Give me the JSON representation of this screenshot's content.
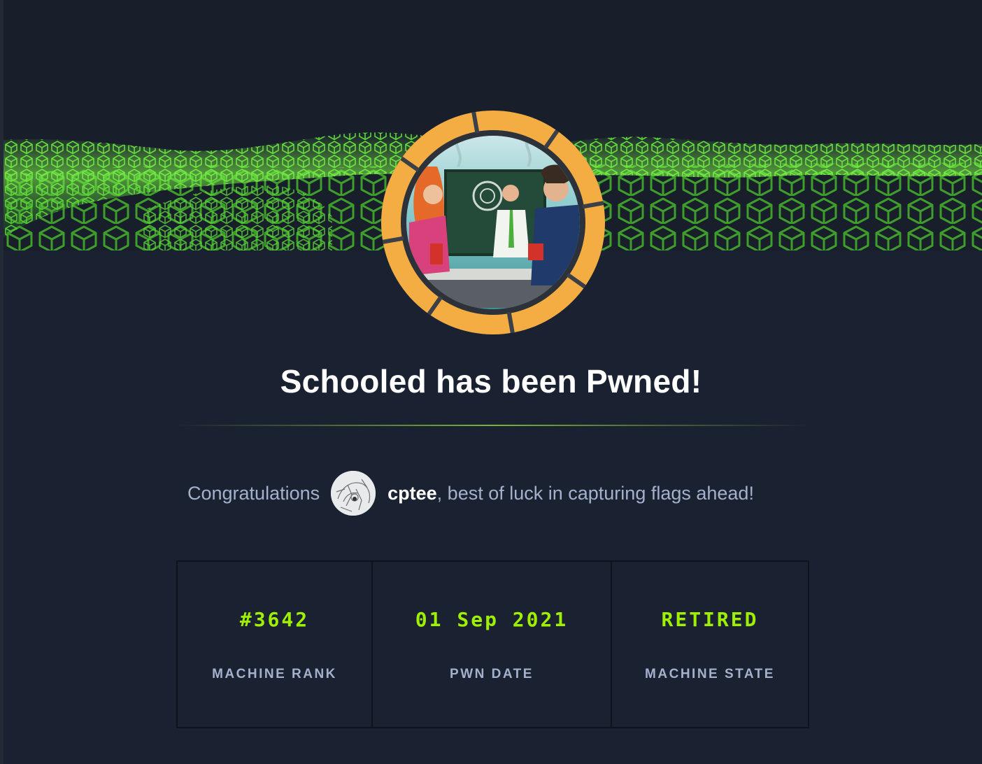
{
  "theme": {
    "accent": "#9fef00",
    "badge_ring": "#f4ad42",
    "background": "#1a2231",
    "muted_text": "#a4b1cd"
  },
  "machine": {
    "name": "Schooled",
    "badge_icon": "machine-avatar-classroom"
  },
  "title": "Schooled has been Pwned!",
  "congrats": {
    "prefix": "Congratulations",
    "username": "cptee",
    "suffix": ", best of luck in capturing flags ahead!",
    "avatar_icon": "user-avatar-sketch"
  },
  "stats": [
    {
      "value": "#3642",
      "label": "MACHINE RANK"
    },
    {
      "value": "01 Sep 2021",
      "label": "PWN DATE"
    },
    {
      "value": "RETIRED",
      "label": "MACHINE STATE"
    }
  ]
}
